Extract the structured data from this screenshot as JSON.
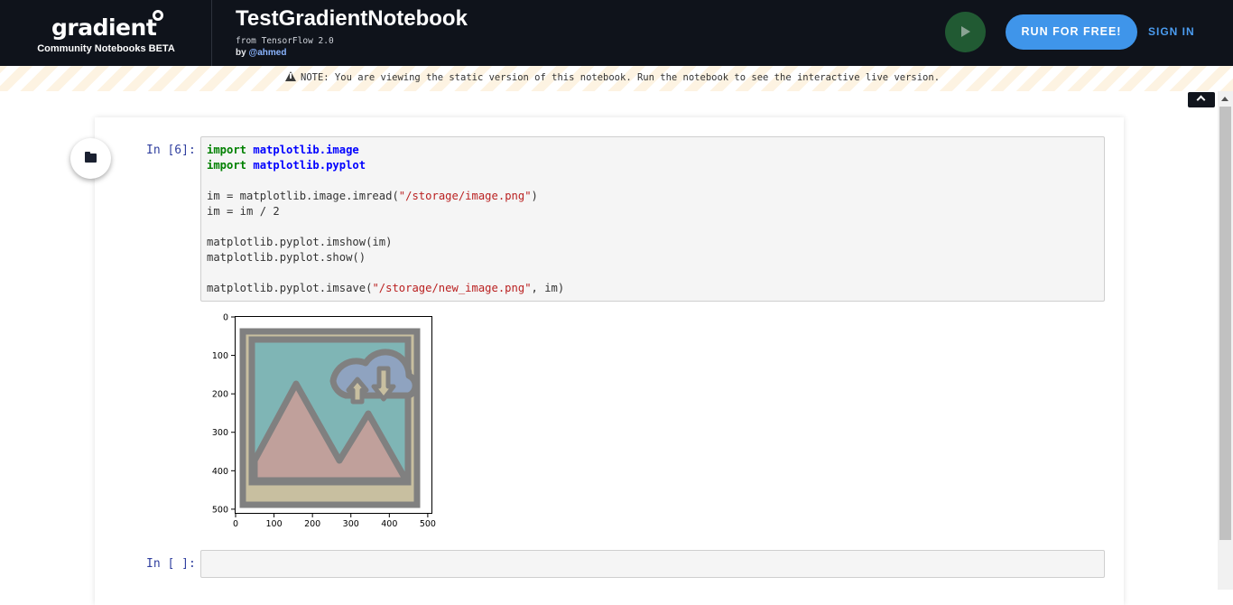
{
  "header": {
    "logo_text": "gradient",
    "logo_subtitle": "Community Notebooks BETA",
    "notebook_title": "TestGradientNotebook",
    "from_text": "from TensorFlow 2.0",
    "by_label": "by",
    "author": "@ahmed",
    "run_for_free_label": "RUN FOR FREE!",
    "sign_in_label": "SIGN IN",
    "run_icon": "play-icon",
    "accent_color": "#3f95ea"
  },
  "notice": {
    "icon": "warning-icon",
    "text": "NOTE: You are viewing the static version of this notebook. Run the notebook to see the interactive live version."
  },
  "notebook": {
    "folder_icon": "folder-icon",
    "cells": [
      {
        "prompt": "In [6]:",
        "lines": [
          {
            "kw": "import",
            "mod": "matplotlib.image"
          },
          {
            "kw": "import",
            "mod": "matplotlib.pyplot"
          },
          {
            "pre": "im = matplotlib.image.imread(",
            "str": "\"/storage/image.png\"",
            "post": ")"
          },
          {
            "pre": "im = im / 2"
          },
          {
            "pre": "matplotlib.pyplot.imshow(im)"
          },
          {
            "pre": "matplotlib.pyplot.show()"
          },
          {
            "pre": "matplotlib.pyplot.imsave(",
            "str": "\"/storage/new_image.png\"",
            "post": ", im)"
          }
        ]
      },
      {
        "prompt": "In [ ]:"
      }
    ]
  },
  "output_plot": {
    "x_ticks": [
      "0",
      "100",
      "200",
      "300",
      "400",
      "500"
    ],
    "y_ticks": [
      "0",
      "100",
      "200",
      "300",
      "400",
      "500"
    ],
    "image_colors": {
      "frame": "#808080",
      "sky": "#7fb5b5",
      "mountain": "#c0a09b",
      "cloud": "#8fa3c0",
      "border_fill": "#c8bfa0"
    }
  }
}
